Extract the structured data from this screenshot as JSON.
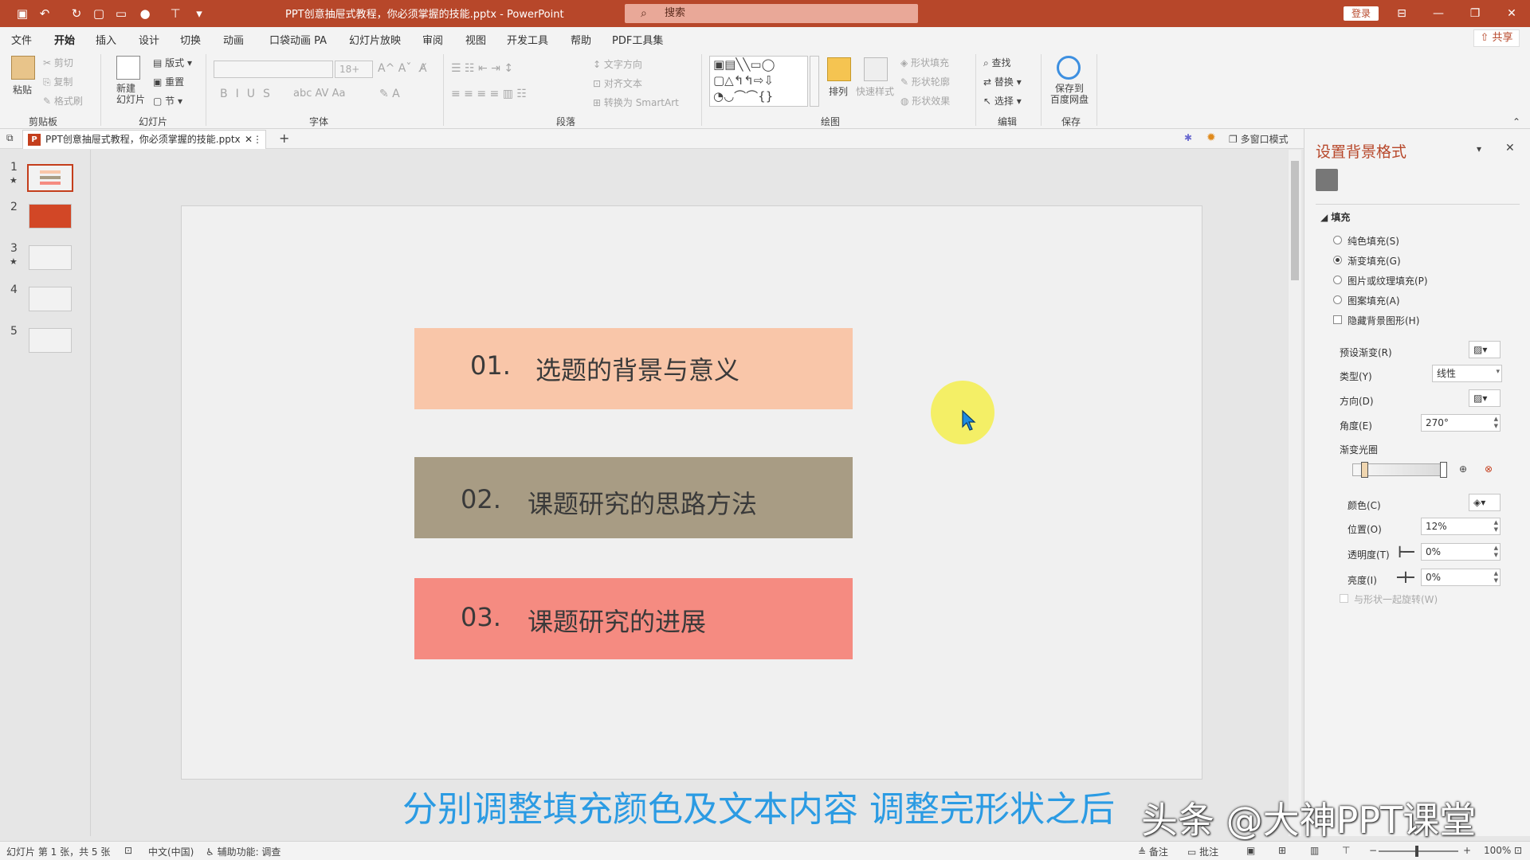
{
  "app": {
    "title": "PPT创意抽屉式教程，你必须掌握的技能.pptx  -  PowerPoint",
    "search_placeholder": "搜索",
    "login_label": "登录",
    "share_label": "共享"
  },
  "menu": [
    "文件",
    "开始",
    "插入",
    "设计",
    "切换",
    "动画",
    "口袋动画 PA",
    "幻灯片放映",
    "审阅",
    "视图",
    "开发工具",
    "帮助",
    "PDF工具集"
  ],
  "menu_active": "开始",
  "ribbon": {
    "clipboard": {
      "label": "剪贴板",
      "paste": "粘贴",
      "cut": "剪切",
      "copy": "复制",
      "format_painter": "格式刷"
    },
    "slides": {
      "label": "幻灯片",
      "new_slide": "新建\n幻灯片",
      "layout": "版式",
      "reset": "重置",
      "section": "节"
    },
    "font": {
      "label": "字体",
      "size": "18+"
    },
    "paragraph": {
      "label": "段落",
      "text_direction": "文字方向",
      "align_text": "对齐文本",
      "convert_smartart": "转换为 SmartArt"
    },
    "drawing": {
      "label": "绘图",
      "arrange": "排列",
      "quick_styles": "快速样式",
      "shape_fill": "形状填充",
      "shape_outline": "形状轮廓",
      "shape_effects": "形状效果"
    },
    "editing": {
      "label": "编辑",
      "find": "查找",
      "replace": "替换",
      "select": "选择"
    },
    "save": {
      "label": "保存",
      "save_to_baidu": "保存到\n百度网盘"
    }
  },
  "doc_tab": {
    "name": "PPT创意抽屉式教程，你必须掌握的技能.pptx",
    "multi_window": "多窗口模式"
  },
  "thumbnails": [
    {
      "num": "1",
      "star": true
    },
    {
      "num": "2",
      "star": false
    },
    {
      "num": "3",
      "star": true
    },
    {
      "num": "4",
      "star": false
    },
    {
      "num": "5",
      "star": false
    }
  ],
  "slide": {
    "items": [
      {
        "num": "01.",
        "text": "选题的背景与意义",
        "color": "#f9c6a9"
      },
      {
        "num": "02.",
        "text": "课题研究的思路方法",
        "color": "#a89c84"
      },
      {
        "num": "03.",
        "text": "课题研究的进展",
        "color": "#f58b81"
      }
    ]
  },
  "caption": "分别调整填充颜色及文本内容 调整完形状之后",
  "watermark": "头条 @大神PPT课堂",
  "pane": {
    "title": "设置背景格式",
    "section": "填充",
    "fill_options": [
      "纯色填充(S)",
      "渐变填充(G)",
      "图片或纹理填充(P)",
      "图案填充(A)"
    ],
    "fill_selected": "渐变填充(G)",
    "hide_bg": "隐藏背景图形(H)",
    "preset": "预设渐变(R)",
    "type_label": "类型(Y)",
    "type_value": "线性",
    "direction": "方向(D)",
    "angle_label": "角度(E)",
    "angle_value": "270°",
    "stops": "渐变光圈",
    "color_label": "颜色(C)",
    "position_label": "位置(O)",
    "position_value": "12%",
    "transparency_label": "透明度(T)",
    "transparency_value": "0%",
    "brightness_label": "亮度(I)",
    "brightness_value": "0%",
    "rotate_with_shape": "与形状一起旋转(W)"
  },
  "status": {
    "slide_info": "幻灯片 第 1 张，共 5 张",
    "language": "中文(中国)",
    "accessibility": "辅助功能: 调查",
    "notes": "备注",
    "comments": "批注",
    "zoom": "100%"
  }
}
